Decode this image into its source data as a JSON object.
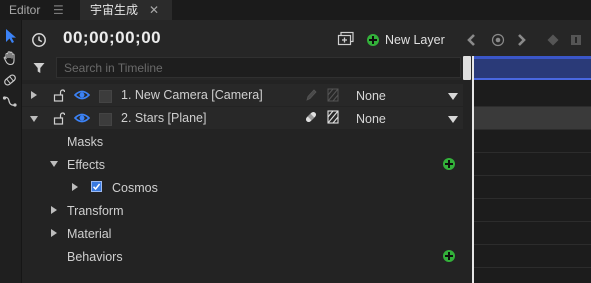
{
  "tabs": [
    {
      "label": "Editor"
    },
    {
      "label": "宇宙生成"
    }
  ],
  "toolbar": {
    "timecode": "00;00;00;00",
    "new_layer_label": "New Layer"
  },
  "search": {
    "placeholder": "Search in Timeline"
  },
  "layers": [
    {
      "name": "1. New Camera [Camera]",
      "parent": "None",
      "expanded": false
    },
    {
      "name": "2. Stars [Plane]",
      "parent": "None",
      "expanded": true
    }
  ],
  "properties": {
    "masks": "Masks",
    "effects": "Effects",
    "effect_items": [
      {
        "name": "Cosmos",
        "enabled": true
      }
    ],
    "transform": "Transform",
    "material": "Material",
    "behaviors": "Behaviors"
  },
  "colors": {
    "accent_blue": "#3a7ae0",
    "add_green": "#33b13a",
    "ruler_blue": "#2a3a78"
  }
}
